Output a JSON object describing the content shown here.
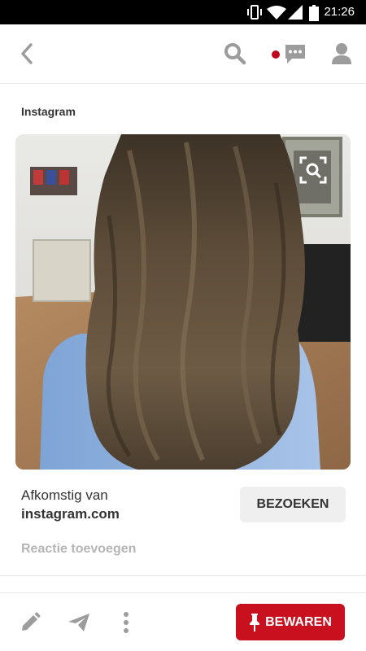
{
  "status_bar": {
    "time": "21:26",
    "icons": [
      "vibrate-icon",
      "wifi-icon",
      "cellular-signal-icon",
      "battery-icon"
    ]
  },
  "top_bar": {
    "icons": [
      "back-arrow-icon",
      "search-icon",
      "notification-dot",
      "messages-icon",
      "profile-icon"
    ]
  },
  "pin": {
    "source_label": "Instagram",
    "from_label": "Afkomstig van",
    "domain": "instagram.com",
    "visit_label": "BEZOEKEN",
    "comment_placeholder": "Reactie toevoegen"
  },
  "bottom_bar": {
    "icons": [
      "edit-pencil-icon",
      "send-icon",
      "more-vertical-icon"
    ],
    "save_label": "BEWAREN"
  },
  "colors": {
    "accent": "#bd081c",
    "save_button": "#c8101f",
    "icon_gray": "#9c9c9c",
    "text": "#333333",
    "muted_text": "#b5b5b5"
  }
}
